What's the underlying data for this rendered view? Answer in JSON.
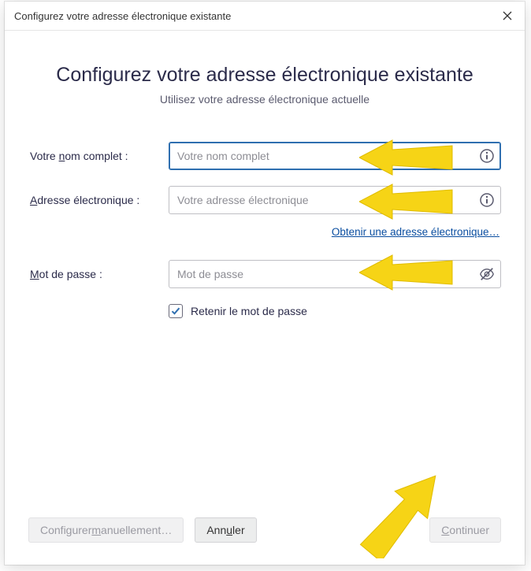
{
  "window": {
    "title": "Configurez votre adresse électronique existante"
  },
  "header": {
    "heading": "Configurez votre adresse électronique existante",
    "subheading": "Utilisez votre adresse électronique actuelle"
  },
  "form": {
    "name": {
      "label_pre": "Votre ",
      "label_accel": "n",
      "label_post": "om complet :",
      "placeholder": "Votre nom complet",
      "value": ""
    },
    "email": {
      "label_accel": "A",
      "label_post": "dresse électronique :",
      "placeholder": "Votre adresse électronique",
      "value": ""
    },
    "get_email_link": {
      "pre": "",
      "accel": "O",
      "post": "btenir une adresse électronique…"
    },
    "password": {
      "label_pre": "",
      "label_accel": "M",
      "label_post": "ot de passe :",
      "placeholder": "Mot de passe",
      "value": ""
    },
    "remember": {
      "checked": true,
      "label_pre": "Retenir le mot de pa",
      "label_accel": "s",
      "label_post": "se"
    }
  },
  "buttons": {
    "manual": {
      "pre": "Configurer ",
      "accel": "m",
      "post": "anuellement…"
    },
    "cancel": {
      "pre": "Ann",
      "accel": "u",
      "post": "ler"
    },
    "continue": {
      "accel": "C",
      "post": "ontinuer"
    }
  },
  "colors": {
    "accent": "#2f6fb0",
    "link": "#0a4ea0",
    "annotation": "#f6d416"
  }
}
